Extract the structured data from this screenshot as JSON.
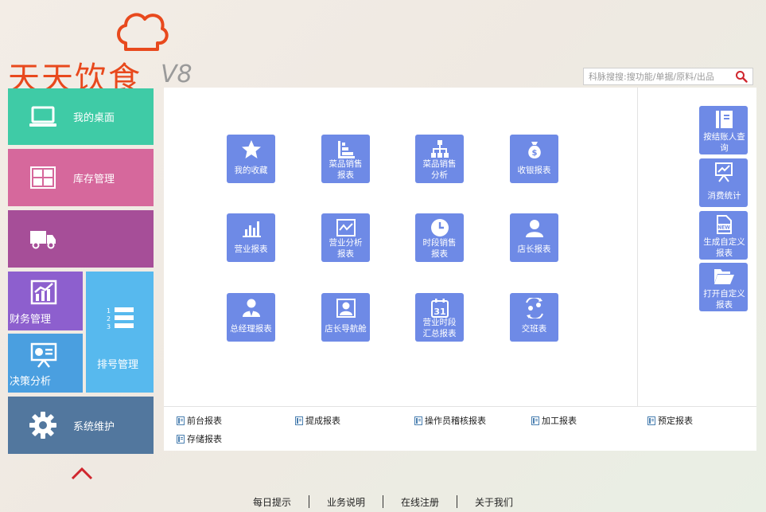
{
  "logo": {
    "text": "天天饮食",
    "version": "V8",
    "brand_color": "#e8491d"
  },
  "search": {
    "placeholder": "科脉搜搜:搜功能/单据/原料/出品",
    "icon": "search-icon"
  },
  "sidebar": {
    "desktop": {
      "label": "我的桌面",
      "icon": "laptop-icon",
      "color": "#3fcba6"
    },
    "inventory": {
      "label": "库存管理",
      "icon": "warehouse-icon",
      "color": "#d6689c"
    },
    "delivery": {
      "label": "",
      "icon": "truck-icon",
      "color": "#a64e98"
    },
    "finance": {
      "label": "财务管理",
      "icon": "chart-growth-icon",
      "color": "#8d5fce"
    },
    "decision": {
      "label": "决策分析",
      "icon": "presentation-icon",
      "color": "#4a9fe0"
    },
    "queue": {
      "label": "排号管理",
      "icon": "numbered-list-icon",
      "color": "#57b9ee"
    },
    "system": {
      "label": "系统维护",
      "icon": "gear-icon",
      "color": "#52779e"
    }
  },
  "reports": [
    {
      "label": "我的收藏",
      "icon": "star-icon"
    },
    {
      "label": "菜品销售报表",
      "line1": "菜品销售",
      "line2": "报表",
      "icon": "bar-steps-icon"
    },
    {
      "label": "菜品销售分析",
      "line1": "菜品销售",
      "line2": "分析",
      "icon": "org-chart-icon"
    },
    {
      "label": "收银报表",
      "icon": "money-bag-icon"
    },
    {
      "label": "营业报表",
      "icon": "bar-chart-icon"
    },
    {
      "label": "营业分析报表",
      "line1": "营业分析",
      "line2": "报表",
      "icon": "line-chart-icon"
    },
    {
      "label": "时段销售报表",
      "line1": "时段销售",
      "line2": "报表",
      "icon": "clock-icon"
    },
    {
      "label": "店长报表",
      "icon": "user-icon"
    },
    {
      "label": "总经理报表",
      "icon": "manager-icon"
    },
    {
      "label": "店长导航舱",
      "icon": "portrait-icon"
    },
    {
      "label": "营业时段汇总报表",
      "line1": "营业时段",
      "line2": "汇总报表",
      "icon": "calendar-31-icon"
    },
    {
      "label": "交班表",
      "icon": "shift-change-icon"
    }
  ],
  "side_actions": [
    {
      "line1": "按结账人查",
      "line2": "询",
      "icon": "notebook-icon"
    },
    {
      "line1": "消费统计",
      "icon": "easel-chart-icon"
    },
    {
      "line1": "生成自定义",
      "line2": "报表",
      "icon": "new-doc-icon"
    },
    {
      "line1": "打开自定义",
      "line2": "报表",
      "icon": "folder-open-icon"
    }
  ],
  "quick_links": [
    "前台报表",
    "提成报表",
    "操作员稽核报表",
    "加工报表",
    "预定报表",
    "存储报表"
  ],
  "footer": [
    "每日提示",
    "业务说明",
    "在线注册",
    "关于我们"
  ],
  "colors": {
    "tile_blue": "#6e8ae6"
  }
}
